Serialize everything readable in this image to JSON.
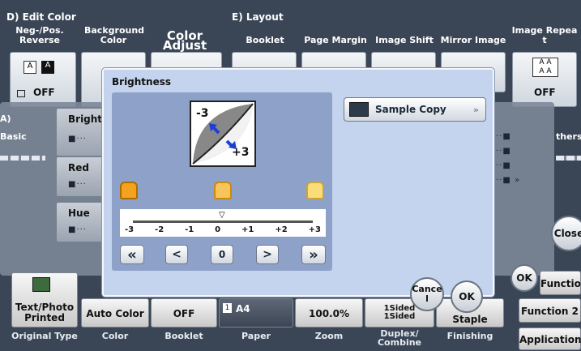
{
  "groups": {
    "edit_color": "D)  Edit Color",
    "layout": "E)  Layout"
  },
  "top_tabs": [
    {
      "label": "Neg-/Pos.\nReverse"
    },
    {
      "label": "Background\nColor"
    },
    {
      "label": "Color Adjust"
    },
    {
      "label": "Booklet"
    },
    {
      "label": "Page Margin"
    },
    {
      "label": "Image Shift"
    },
    {
      "label": "Mirror Image"
    },
    {
      "label": "Image Repea\nt"
    }
  ],
  "neg_pos_value": "OFF",
  "image_repeat_value": "OFF",
  "left_panel": {
    "title": "A)",
    "sub": "Basic",
    "items": [
      "Brightn",
      "Red",
      "Hue"
    ]
  },
  "right_panel": {
    "sub": "thers",
    "close": "Close",
    "ok": "OK"
  },
  "bottom_tiles": [
    {
      "label": "Text/Photo\nPrinted",
      "foot": "Original Type"
    },
    {
      "label": "Auto Color",
      "foot": "Color"
    },
    {
      "label": "OFF",
      "foot": "Booklet"
    },
    {
      "label": "A4",
      "foot": "Paper"
    },
    {
      "label": "100.0%",
      "foot": "Zoom"
    },
    {
      "label": "1Sided\n1Sided",
      "foot": "Duplex/\nCombine"
    },
    {
      "label": "Staple",
      "foot": "Finishing"
    }
  ],
  "function_buttons": [
    "Function 1",
    "Function 2",
    "Application"
  ],
  "dialog": {
    "title": "Brightness",
    "icon_minus": "-3",
    "icon_plus": "+3",
    "scale": [
      "-3",
      "-2",
      "-1",
      "0",
      "+1",
      "+2",
      "+3"
    ],
    "value": "0",
    "btn_far_left": "«",
    "btn_left": "<",
    "btn_right": ">",
    "btn_far_right": "»",
    "sample_copy": "Sample Copy",
    "cancel": "Cance\nl",
    "ok": "OK"
  },
  "colors": {
    "dialog_bg": "#c4d4ee",
    "control_panel": "#8ea1c8",
    "toast_orange": "#f4a31e",
    "toast_yellow": "#fbdc7a"
  }
}
